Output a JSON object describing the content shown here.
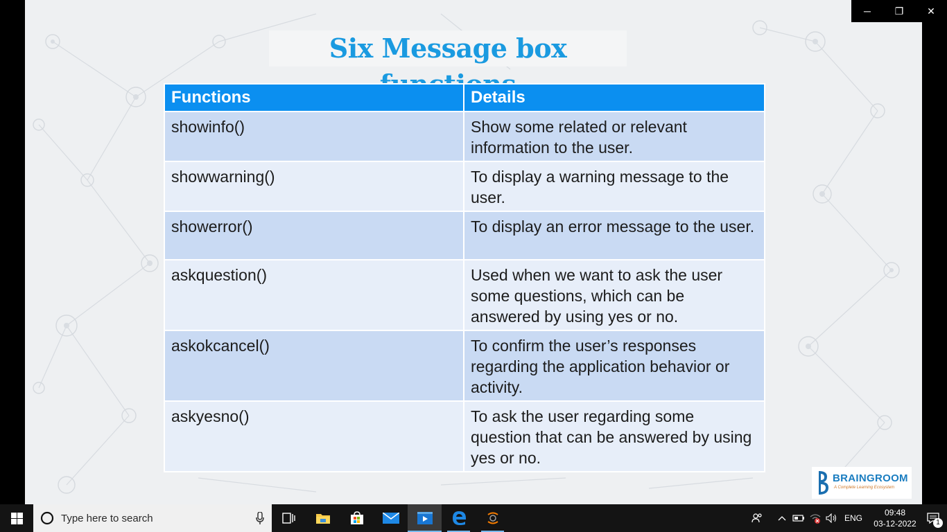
{
  "slide": {
    "title": "Six Message box functions",
    "table": {
      "headers": [
        "Functions",
        "Details"
      ],
      "rows": [
        {
          "function": "showinfo()",
          "details": "Show some related or relevant information to the user."
        },
        {
          "function": "showwarning()",
          "details": "To display a warning message to the user."
        },
        {
          "function": "showerror()",
          "details": "To display an error message to the user."
        },
        {
          "function": "askquestion()",
          "details": "Used when we want to ask the user some questions, which can be answered by using yes or no."
        },
        {
          "function": "askokcancel()",
          "details": "To confirm the user’s responses regarding the application behavior or activity."
        },
        {
          "function": "askyesno()",
          "details": " To ask the user regarding some question that can be answered by using yes or no."
        }
      ]
    },
    "logo": {
      "name": "BRAINGROOM",
      "tagline": "A Complete Learning Ecosystem"
    }
  },
  "window_controls": {
    "minimize": "─",
    "restore": "❐",
    "close": "✕"
  },
  "taskbar": {
    "search_placeholder": "Type here to search",
    "apps": [
      "task-view",
      "file-explorer",
      "microsoft-store",
      "mail",
      "video-player",
      "edge",
      "app"
    ],
    "tray": {
      "language": "ENG",
      "time": "09:48",
      "date": "03-12-2022",
      "notification_count": "1"
    }
  },
  "colors": {
    "accent": "#0b8ff0",
    "title": "#1a9ae0",
    "row_dark": "#c9daf3",
    "row_light": "#e7eef9"
  }
}
